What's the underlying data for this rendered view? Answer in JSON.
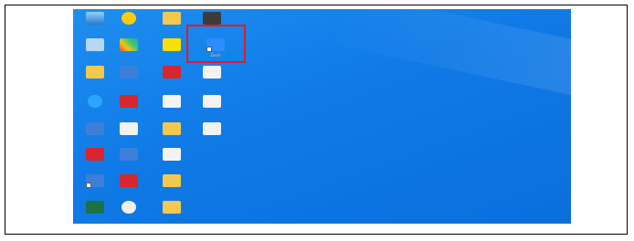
{
  "icons": [
    {
      "label": ""
    },
    {
      "label": ""
    },
    {
      "label": ""
    },
    {
      "label": ""
    },
    {
      "label": ""
    },
    {
      "label": ""
    },
    {
      "label": ""
    },
    {
      "label": ""
    },
    {
      "label": ""
    },
    {
      "label": ""
    },
    {
      "label": ""
    },
    {
      "label": ""
    },
    {
      "label": ""
    },
    {
      "label": ""
    },
    {
      "label": ""
    },
    {
      "label": ""
    },
    {
      "label": ""
    },
    {
      "label": ""
    },
    {
      "label": ""
    },
    {
      "label": ""
    },
    {
      "label": ""
    },
    {
      "label": ""
    },
    {
      "label": ""
    },
    {
      "label": ""
    },
    {
      "label": ""
    },
    {
      "label": ""
    },
    {
      "label": ""
    },
    {
      "label": ""
    },
    {
      "label": "Zoom"
    }
  ],
  "colors": {
    "desktop_background": "#0f7ae6",
    "highlight": "#e31b23"
  }
}
